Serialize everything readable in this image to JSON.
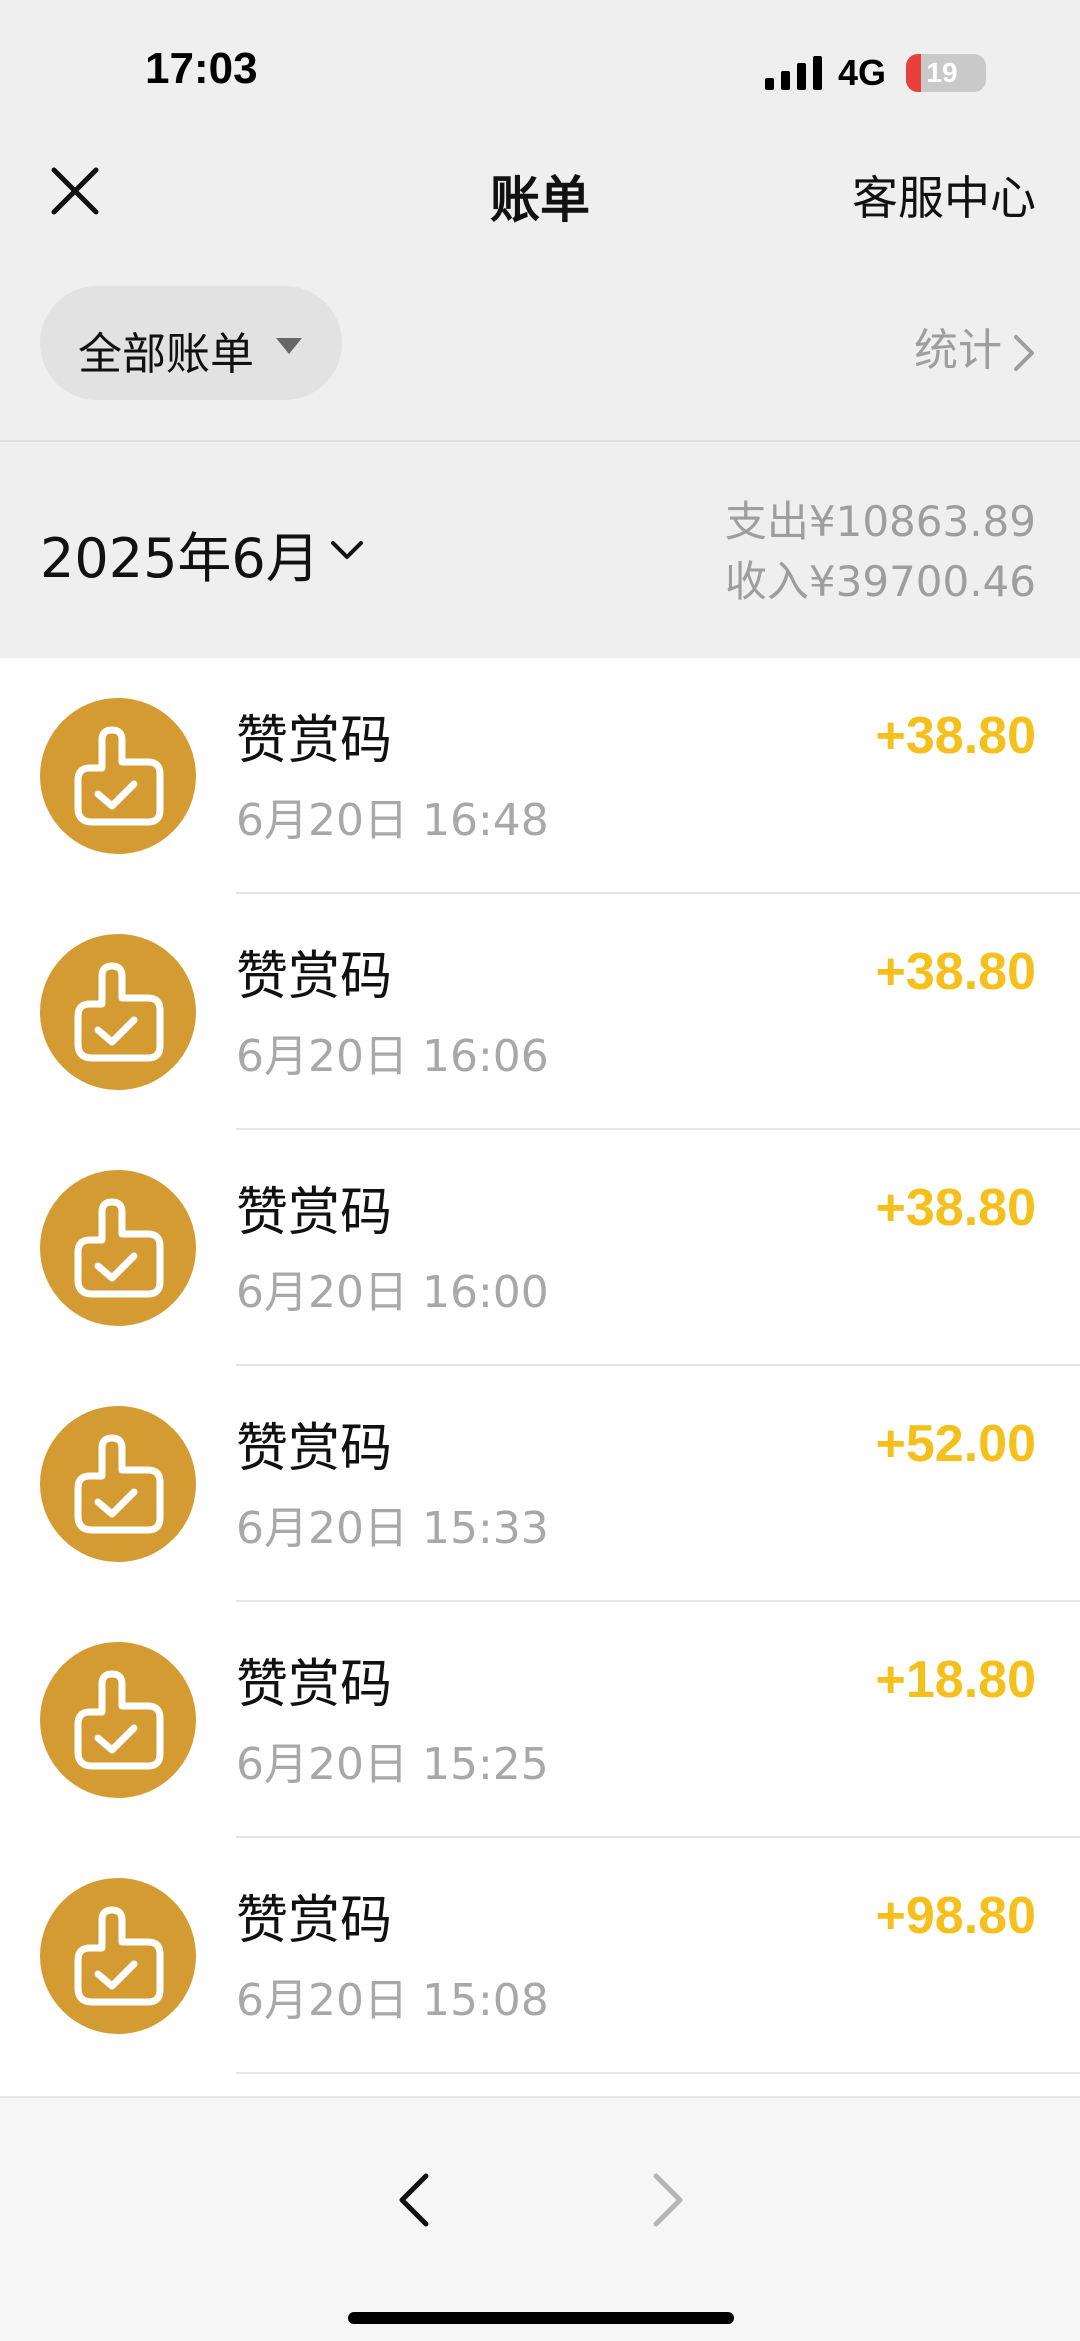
{
  "status_bar": {
    "time": "17:03",
    "network": "4G",
    "battery_level": "19",
    "battery_fraction": 0.19
  },
  "nav": {
    "title": "账单",
    "close_icon": "close-icon",
    "service_label": "客服中心"
  },
  "filter": {
    "label": "全部账单",
    "stats_label": "统计"
  },
  "month": {
    "label": "2025年6月",
    "expense": "支出¥10863.89",
    "income": "收入¥39700.46"
  },
  "colors": {
    "accent": "#f5c01b",
    "avatar_bg": "#d59b33",
    "muted": "#9e9e9e"
  },
  "transactions": [
    {
      "title": "赞赏码",
      "time": "6月20日 16:48",
      "amount": "+38.80",
      "icon": "thumbs-up-icon"
    },
    {
      "title": "赞赏码",
      "time": "6月20日 16:06",
      "amount": "+38.80",
      "icon": "thumbs-up-icon"
    },
    {
      "title": "赞赏码",
      "time": "6月20日 16:00",
      "amount": "+38.80",
      "icon": "thumbs-up-icon"
    },
    {
      "title": "赞赏码",
      "time": "6月20日 15:33",
      "amount": "+52.00",
      "icon": "thumbs-up-icon"
    },
    {
      "title": "赞赏码",
      "time": "6月20日 15:25",
      "amount": "+18.80",
      "icon": "thumbs-up-icon"
    },
    {
      "title": "赞赏码",
      "time": "6月20日 15:08",
      "amount": "+98.80",
      "icon": "thumbs-up-icon"
    }
  ],
  "bottom_bar": {
    "back_icon": "chevron-left-icon",
    "forward_icon": "chevron-right-icon"
  }
}
